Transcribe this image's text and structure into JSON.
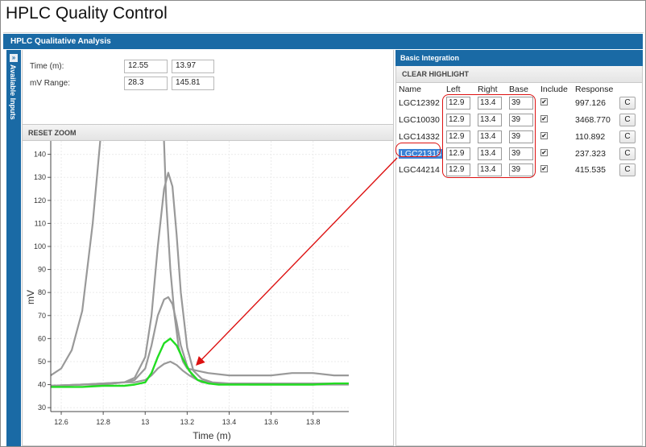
{
  "app": {
    "title": "HPLC Quality Control"
  },
  "panel": {
    "title": "HPLC Qualitative Analysis"
  },
  "sidebar": {
    "toggle_icon": "double-chevron-right-icon",
    "label": "Available Inputs"
  },
  "inputs": {
    "time": {
      "label": "Time (m):",
      "min": "12.55",
      "max": "13.97"
    },
    "mv_range": {
      "label": "mV Range:",
      "min": "28.3",
      "max": "145.81"
    }
  },
  "toolbar": {
    "reset_zoom": "RESET ZOOM"
  },
  "integration": {
    "title": "Basic Integration",
    "clear_highlight": "CLEAR HIGHLIGHT",
    "columns": {
      "name": "Name",
      "left": "Left",
      "right": "Right",
      "base": "Base",
      "include": "Include",
      "response": "Response"
    },
    "rows": [
      {
        "name": "LGC12392",
        "left": "12.9",
        "right": "13.4",
        "base": "39",
        "include": true,
        "response": "997.126",
        "button": "C"
      },
      {
        "name": "LGC10030",
        "left": "12.9",
        "right": "13.4",
        "base": "39",
        "include": true,
        "response": "3468.770",
        "button": "C"
      },
      {
        "name": "LGC14332",
        "left": "12.9",
        "right": "13.4",
        "base": "39",
        "include": true,
        "response": "110.892",
        "button": "C"
      },
      {
        "name": "LGC21318",
        "left": "12.9",
        "right": "13.4",
        "base": "39",
        "include": true,
        "response": "237.323",
        "button": "C",
        "selected": true
      },
      {
        "name": "LGC44214",
        "left": "12.9",
        "right": "13.4",
        "base": "39",
        "include": true,
        "response": "415.535",
        "button": "C"
      }
    ]
  },
  "colors": {
    "accent": "#1a6aa5",
    "highlight": "#22dd22",
    "trace": "#999999",
    "annotation": "#dd1111"
  },
  "chart_data": {
    "type": "line",
    "xlabel": "Time (m)",
    "ylabel": "mV",
    "xlim": [
      12.55,
      13.97
    ],
    "ylim": [
      28.3,
      145.81
    ],
    "xticks": [
      "12.6",
      "12.8",
      "13",
      "13.2",
      "13.4",
      "13.6",
      "13.8"
    ],
    "yticks": [
      "30",
      "40",
      "50",
      "60",
      "70",
      "80",
      "90",
      "100",
      "110",
      "120",
      "130",
      "140"
    ],
    "series": [
      {
        "x": [
          12.55,
          12.6,
          12.65,
          12.7,
          12.75,
          12.8,
          12.85,
          12.9,
          12.95,
          13.0,
          13.02,
          13.04,
          13.06,
          13.08,
          13.1,
          13.12,
          13.14,
          13.16,
          13.18,
          13.2,
          13.25,
          13.3,
          13.4,
          13.5,
          13.6,
          13.7,
          13.8,
          13.9,
          13.97
        ],
        "y": [
          44,
          47,
          55,
          72,
          110,
          160,
          240,
          320,
          400,
          420,
          400,
          320,
          230,
          170,
          120,
          90,
          70,
          56,
          50,
          47,
          46,
          45,
          44,
          44,
          44,
          45,
          45,
          44,
          44
        ],
        "color": "#999999"
      },
      {
        "x": [
          12.55,
          12.7,
          12.8,
          12.9,
          12.95,
          13.0,
          13.03,
          13.06,
          13.09,
          13.11,
          13.13,
          13.15,
          13.17,
          13.2,
          13.23,
          13.27,
          13.32,
          13.4,
          13.5,
          13.6,
          13.7,
          13.8,
          13.9,
          13.97
        ],
        "y": [
          39.5,
          40,
          40.5,
          41,
          43,
          52,
          70,
          100,
          125,
          132,
          126,
          105,
          80,
          56,
          46,
          42.5,
          41,
          40.5,
          40.5,
          40.5,
          40.5,
          40.5,
          40.5,
          40.5
        ],
        "color": "#999999"
      },
      {
        "x": [
          12.55,
          12.7,
          12.8,
          12.9,
          12.95,
          13.0,
          13.03,
          13.06,
          13.09,
          13.11,
          13.13,
          13.15,
          13.17,
          13.2,
          13.23,
          13.27,
          13.32,
          13.4,
          13.5,
          13.6,
          13.7,
          13.8,
          13.9,
          13.97
        ],
        "y": [
          39.5,
          40,
          40.5,
          41,
          42,
          47,
          57,
          70,
          77,
          78,
          75,
          67,
          57,
          48,
          43,
          41,
          40.5,
          40.5,
          40.5,
          40.5,
          40.5,
          40.5,
          40.5,
          40.5
        ],
        "color": "#999999"
      },
      {
        "x": [
          12.55,
          12.7,
          12.8,
          12.9,
          12.95,
          13.0,
          13.03,
          13.06,
          13.09,
          13.12,
          13.15,
          13.18,
          13.21,
          13.25,
          13.3,
          13.35,
          13.4,
          13.5,
          13.6,
          13.7,
          13.8,
          13.9,
          13.97
        ],
        "y": [
          39.5,
          40,
          40,
          41,
          41,
          42,
          44,
          47,
          49,
          50,
          48.5,
          46,
          44,
          42,
          41,
          40.5,
          40.5,
          40,
          40,
          40,
          40,
          40,
          40
        ],
        "color": "#999999"
      },
      {
        "x": [
          12.55,
          12.7,
          12.8,
          12.9,
          12.95,
          13.0,
          13.03,
          13.06,
          13.09,
          13.12,
          13.15,
          13.18,
          13.21,
          13.25,
          13.3,
          13.35,
          13.4,
          13.5,
          13.6,
          13.7,
          13.8,
          13.9,
          13.97
        ],
        "y": [
          39,
          39,
          39.5,
          39.5,
          40,
          41,
          45,
          52,
          58,
          60,
          57,
          51,
          46,
          42,
          40.5,
          40,
          40,
          40,
          40,
          40,
          40,
          40.5,
          40.5
        ],
        "color": "#22dd22"
      }
    ]
  }
}
